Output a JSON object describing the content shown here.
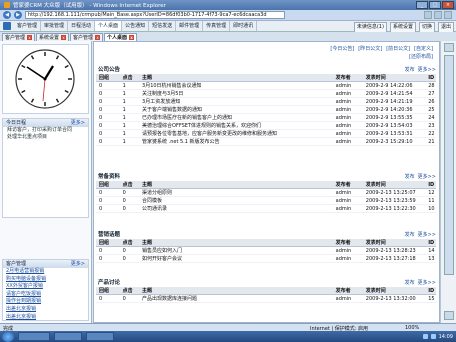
{
  "browser": {
    "title": "管家婆CRM 大众版（试用版） - Windows Internet Explorer",
    "url": "http://192.168.1.111/crmpub/Main_Base.aspx?UserID=86df03b0-1717-4f73-9ca7-ec6dcaaca3d",
    "status_left": "完成",
    "status_zone": "Internet | 保护模式: 启用",
    "zoom": "100%",
    "clock": "14:09"
  },
  "menu": {
    "items": [
      "客户管理",
      "审批管理",
      "日程活动",
      "个人桌面",
      "公告通知",
      "短信发送",
      "邮件管理",
      "传真管理",
      "即时通讯"
    ],
    "active_index": 3,
    "right": [
      "未读信息(1)",
      "系统设置",
      "切换",
      "退出"
    ]
  },
  "tabs": [
    "客户管理",
    "系统设置",
    "客户管理",
    "个人桌面"
  ],
  "left": {
    "todo_title": "今日日程",
    "more": "更多>",
    "todo_items": [
      "拜访客户，打印采购订单合同",
      "处理华北重点项目"
    ],
    "cust_title": "客户管理",
    "cust_items": [
      "2月电话营销报销",
      "购买电脑设备报销",
      "XX外贸客户报销",
      "请客户吃饭报销",
      "操作台到期报销",
      "出差北京报销",
      "出差北京报销"
    ]
  },
  "main": {
    "toplinks": [
      "[今日公告]",
      "[昨日公文]",
      "[前日公文]",
      "[自定义]"
    ],
    "restore": "[还原布局]",
    "panels": [
      {
        "title": "公司公告",
        "actions": [
          "发布",
          "更多>>"
        ],
        "headers": [
          "回组",
          "点击",
          "主题",
          "发布者",
          "发表时间",
          "ID"
        ],
        "rows": [
          [
            "0",
            "1",
            "3月10日杭州销售会议通知",
            "admin",
            "2009-2-9 14:22:06",
            "28"
          ],
          [
            "0",
            "1",
            "关注制度与3月5日",
            "admin",
            "2009-2-9 14:21:54",
            "27"
          ],
          [
            "0",
            "1",
            "3月工资发放通知",
            "admin",
            "2009-2-9 14:21:19",
            "26"
          ],
          [
            "0",
            "1",
            "关于客户端销售数据的通知",
            "admin",
            "2009-2-9 14:20:36",
            "25"
          ],
          [
            "0",
            "1",
            "已办理市场医疗在新的销售客户上的通知",
            "admin",
            "2009-2-9 13:55:35",
            "24"
          ],
          [
            "0",
            "1",
            "美德治理综合OFFSET体进规则的销售关系，欢迎你们",
            "admin",
            "2009-2-9 13:54:03",
            "23"
          ],
          [
            "0",
            "1",
            "请预报各位零售基地，应客户服务新变更改的维修和服务通知",
            "admin",
            "2009-2-9 13:53:31",
            "22"
          ],
          [
            "0",
            "1",
            "管家婆系统 .net 5.1 新版发布公告",
            "admin",
            "2009-2-3 15:29:10",
            "21"
          ]
        ]
      },
      {
        "title": "常备资料",
        "actions": [
          "发布",
          "更多>>"
        ],
        "headers": [
          "回组",
          "点击",
          "主题",
          "发布者",
          "发表时间",
          "ID"
        ],
        "rows": [
          [
            "0",
            "0",
            "渠道分组原则",
            "admin",
            "2009-2-13 13:25:07",
            "12"
          ],
          [
            "0",
            "0",
            "合同模板",
            "admin",
            "2009-2-13 13:23:59",
            "11"
          ],
          [
            "0",
            "0",
            "公司通讯录",
            "admin",
            "2009-2-13 13:22:30",
            "10"
          ]
        ]
      },
      {
        "title": "营销话题",
        "actions": [
          "发布",
          "更多>>"
        ],
        "headers": [
          "回组",
          "点击",
          "主题",
          "发布者",
          "发表时间",
          "ID"
        ],
        "rows": [
          [
            "0",
            "0",
            "销售员应如何入门",
            "admin",
            "2009-2-13 13:28:23",
            "14"
          ],
          [
            "0",
            "0",
            "如何开好客户会议",
            "admin",
            "2009-2-13 13:27:18",
            "13"
          ]
        ]
      },
      {
        "title": "产品讨论",
        "actions": [
          "发布",
          "更多>>"
        ],
        "headers": [
          "回组",
          "点击",
          "主题",
          "发布者",
          "发表时间",
          "ID"
        ],
        "rows": [
          [
            "0",
            "0",
            "产品出现数据库连接问题",
            "admin",
            "2009-2-13 13:32:00",
            "15"
          ]
        ]
      }
    ]
  }
}
